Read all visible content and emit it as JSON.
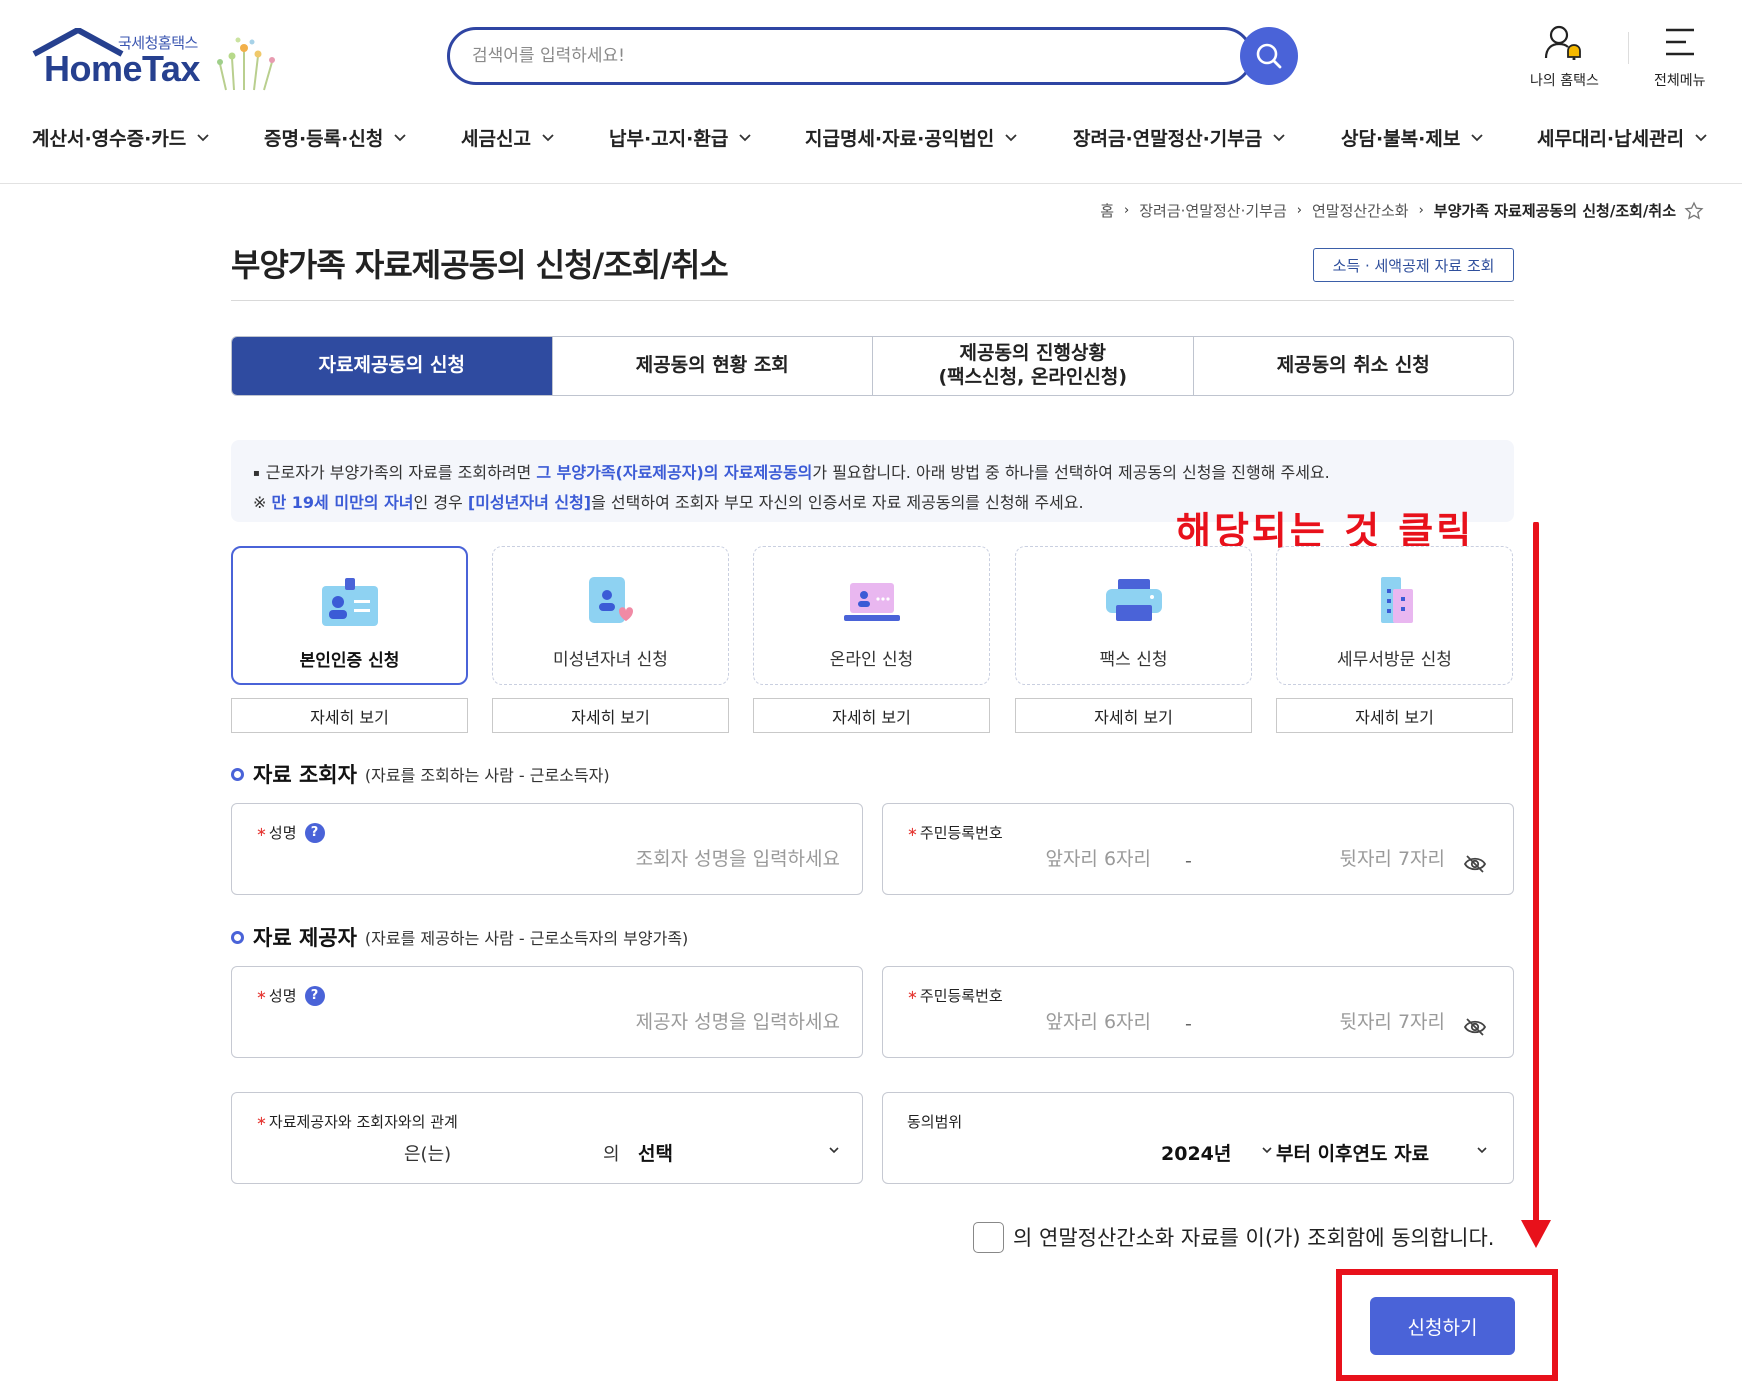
{
  "header": {
    "logo_sub": "국세청홈택스",
    "logo_main": "HomeTax",
    "search_placeholder": "검색어를 입력하세요!",
    "my_hometax": "나의 홈택스",
    "all_menu": "전체메뉴"
  },
  "gnb": [
    "계산서·영수증·카드",
    "증명·등록·신청",
    "세금신고",
    "납부·고지·환급",
    "지급명세·자료·공익법인",
    "장려금·연말정산·기부금",
    "상담·불복·제보",
    "세무대리·납세관리"
  ],
  "breadcrumb": [
    "홈",
    "장려금·연말정산·기부금",
    "연말정산간소화",
    "부양가족 자료제공동의 신청/조회/취소"
  ],
  "page_title": "부양가족 자료제공동의 신청/조회/취소",
  "title_button": "소득 · 세액공제 자료 조회",
  "tabs": [
    "자료제공동의 신청",
    "제공동의 현황 조회",
    "제공동의 진행상황\n(팩스신청, 온라인신청)",
    "제공동의 취소 신청"
  ],
  "notice": {
    "l1_a": "근로자가 부양가족의 자료를 조회하려면 ",
    "l1_hl": "그 부양가족(자료제공자)의 자료제공동의",
    "l1_b": "가 필요합니다. 아래 방법 중 하나를 선택하여 제공동의 신청을 진행해 주세요.",
    "l2_a": "※ ",
    "l2_hl1": "만 19세 미만의 자녀",
    "l2_b": "인 경우 ",
    "l2_hl2": "[미성년자녀 신청]",
    "l2_c": "을 선택하여 조회자 부모 자신의 인증서로 자료 제공동의를 신청해 주세요."
  },
  "methods": [
    {
      "label": "본인인증 신청",
      "detail": "자세히 보기"
    },
    {
      "label": "미성년자녀 신청",
      "detail": "자세히 보기"
    },
    {
      "label": "온라인 신청",
      "detail": "자세히 보기"
    },
    {
      "label": "팩스 신청",
      "detail": "자세히 보기"
    },
    {
      "label": "세무서방문 신청",
      "detail": "자세히 보기"
    }
  ],
  "viewer_section": {
    "title": "자료 조회자",
    "sub": "(자료를 조회하는 사람 - 근로소득자)",
    "name_label": "성명",
    "name_placeholder": "조회자 성명을 입력하세요",
    "rrn_label": "주민등록번호",
    "rrn_front_placeholder": "앞자리 6자리",
    "rrn_back_placeholder": "뒷자리 7자리"
  },
  "provider_section": {
    "title": "자료 제공자",
    "sub": "(자료를 제공하는 사람 - 근로소득자의 부양가족)",
    "name_label": "성명",
    "name_placeholder": "제공자 성명을 입력하세요",
    "rrn_label": "주민등록번호",
    "rrn_front_placeholder": "앞자리 6자리",
    "rrn_back_placeholder": "뒷자리 7자리"
  },
  "relation": {
    "label": "자료제공자와 조회자와의 관계",
    "eun": "은(는)",
    "ui": "의",
    "select_value": "선택"
  },
  "scope": {
    "label": "동의범위",
    "year_value": "2024년",
    "range_value": "부터 이후연도 자료"
  },
  "dash": "-",
  "agree_text": "의 연말정산간소화 자료를 이(가) 조회함에 동의합니다.",
  "submit_label": "신청하기",
  "annotation": "해당되는 것 클릭",
  "colors": {
    "primary": "#4a63d8",
    "navy": "#2f4ba0",
    "annotation_red": "#e8111b"
  }
}
